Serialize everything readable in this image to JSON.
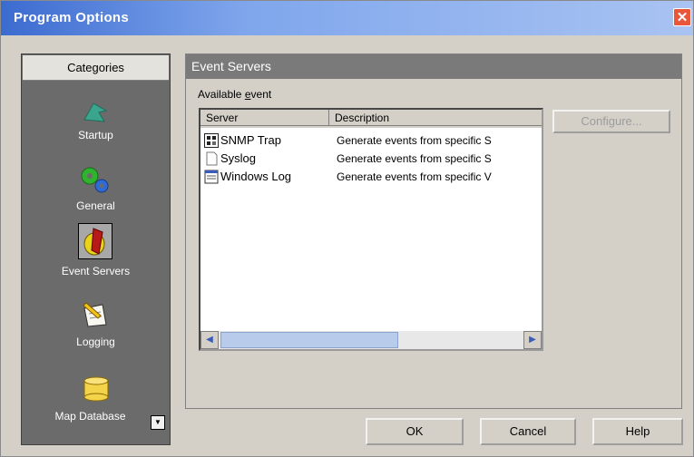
{
  "window": {
    "title": "Program Options",
    "close_glyph": "✕"
  },
  "categories": {
    "header": "Categories",
    "items": [
      {
        "label": "Startup",
        "icon": "arrow-icon"
      },
      {
        "label": "General",
        "icon": "gears-icon"
      },
      {
        "label": "Event Servers",
        "icon": "event-alert-icon",
        "selected": true
      },
      {
        "label": "Logging",
        "icon": "notepad-pencil-icon"
      },
      {
        "label": "Map Database",
        "icon": "database-icon"
      }
    ],
    "scroll_glyph": "▼"
  },
  "panel": {
    "title": "Event Servers",
    "available_label": {
      "pre": "Available ",
      "underlined": "e",
      "post": "vent"
    }
  },
  "list": {
    "columns": [
      "Server",
      "Description"
    ],
    "rows": [
      {
        "server": "SNMP Trap",
        "description": "Generate events from specific S",
        "icon": "snmp-icon"
      },
      {
        "server": "Syslog",
        "description": "Generate events from specific S",
        "icon": "document-icon"
      },
      {
        "server": "Windows Log",
        "description": "Generate events from specific V",
        "icon": "windows-log-icon"
      }
    ],
    "scroll_left": "◀",
    "scroll_right": "▶"
  },
  "buttons": {
    "configure": "Configure...",
    "ok": "OK",
    "cancel": "Cancel",
    "help": "Help"
  },
  "colors": {
    "title_gradient_start": "#3c6bd0",
    "category_bg": "#6b6b6b",
    "panel_header": "#7a7a7a"
  }
}
